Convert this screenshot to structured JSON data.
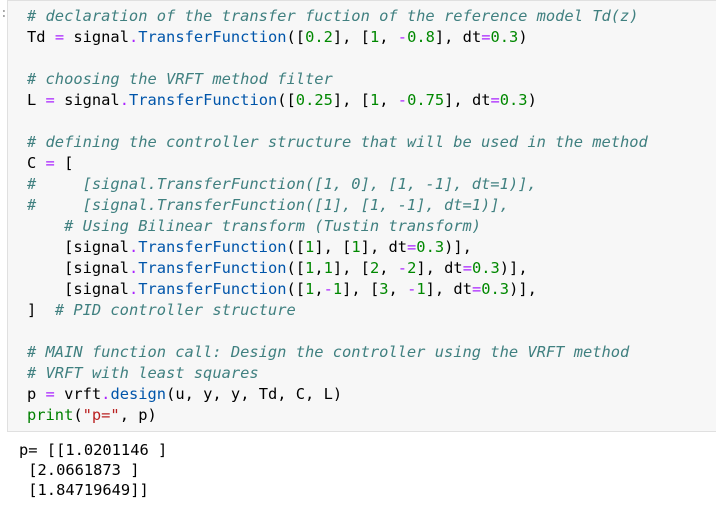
{
  "cell": {
    "prompt_mark": ":",
    "lines": [
      [
        {
          "t": "cm",
          "v": "# declaration of the transfer fuction of the reference model Td(z)"
        }
      ],
      [
        {
          "t": "p",
          "v": "Td "
        },
        {
          "t": "op",
          "v": "="
        },
        {
          "t": "p",
          "v": " signal"
        },
        {
          "t": "op",
          "v": "."
        },
        {
          "t": "fn",
          "v": "TransferFunction"
        },
        {
          "t": "p",
          "v": "(["
        },
        {
          "t": "num",
          "v": "0.2"
        },
        {
          "t": "p",
          "v": "], ["
        },
        {
          "t": "num",
          "v": "1"
        },
        {
          "t": "p",
          "v": ", "
        },
        {
          "t": "op",
          "v": "-"
        },
        {
          "t": "num",
          "v": "0.8"
        },
        {
          "t": "p",
          "v": "], dt"
        },
        {
          "t": "op",
          "v": "="
        },
        {
          "t": "num",
          "v": "0.3"
        },
        {
          "t": "p",
          "v": ")"
        }
      ],
      [],
      [
        {
          "t": "cm",
          "v": "# choosing the VRFT method filter"
        }
      ],
      [
        {
          "t": "p",
          "v": "L "
        },
        {
          "t": "op",
          "v": "="
        },
        {
          "t": "p",
          "v": " signal"
        },
        {
          "t": "op",
          "v": "."
        },
        {
          "t": "fn",
          "v": "TransferFunction"
        },
        {
          "t": "p",
          "v": "(["
        },
        {
          "t": "num",
          "v": "0.25"
        },
        {
          "t": "p",
          "v": "], ["
        },
        {
          "t": "num",
          "v": "1"
        },
        {
          "t": "p",
          "v": ", "
        },
        {
          "t": "op",
          "v": "-"
        },
        {
          "t": "num",
          "v": "0.75"
        },
        {
          "t": "p",
          "v": "], dt"
        },
        {
          "t": "op",
          "v": "="
        },
        {
          "t": "num",
          "v": "0.3"
        },
        {
          "t": "p",
          "v": ")"
        }
      ],
      [],
      [
        {
          "t": "cm",
          "v": "# defining the controller structure that will be used in the method"
        }
      ],
      [
        {
          "t": "p",
          "v": "C "
        },
        {
          "t": "op",
          "v": "="
        },
        {
          "t": "p",
          "v": " ["
        }
      ],
      [
        {
          "t": "cm",
          "v": "#     [signal.TransferFunction([1, 0], [1, -1], dt=1)],"
        }
      ],
      [
        {
          "t": "cm",
          "v": "#     [signal.TransferFunction([1], [1, -1], dt=1)],"
        }
      ],
      [
        {
          "t": "p",
          "v": "    "
        },
        {
          "t": "cm",
          "v": "# Using Bilinear transform (Tustin transform)"
        }
      ],
      [
        {
          "t": "p",
          "v": "    [signal"
        },
        {
          "t": "op",
          "v": "."
        },
        {
          "t": "fn",
          "v": "TransferFunction"
        },
        {
          "t": "p",
          "v": "(["
        },
        {
          "t": "num",
          "v": "1"
        },
        {
          "t": "p",
          "v": "], ["
        },
        {
          "t": "num",
          "v": "1"
        },
        {
          "t": "p",
          "v": "], dt"
        },
        {
          "t": "op",
          "v": "="
        },
        {
          "t": "num",
          "v": "0.3"
        },
        {
          "t": "p",
          "v": ")],"
        }
      ],
      [
        {
          "t": "p",
          "v": "    [signal"
        },
        {
          "t": "op",
          "v": "."
        },
        {
          "t": "fn",
          "v": "TransferFunction"
        },
        {
          "t": "p",
          "v": "(["
        },
        {
          "t": "num",
          "v": "1"
        },
        {
          "t": "p",
          "v": ","
        },
        {
          "t": "num",
          "v": "1"
        },
        {
          "t": "p",
          "v": "], ["
        },
        {
          "t": "num",
          "v": "2"
        },
        {
          "t": "p",
          "v": ", "
        },
        {
          "t": "op",
          "v": "-"
        },
        {
          "t": "num",
          "v": "2"
        },
        {
          "t": "p",
          "v": "], dt"
        },
        {
          "t": "op",
          "v": "="
        },
        {
          "t": "num",
          "v": "0.3"
        },
        {
          "t": "p",
          "v": ")],"
        }
      ],
      [
        {
          "t": "p",
          "v": "    [signal"
        },
        {
          "t": "op",
          "v": "."
        },
        {
          "t": "fn",
          "v": "TransferFunction"
        },
        {
          "t": "p",
          "v": "(["
        },
        {
          "t": "num",
          "v": "1"
        },
        {
          "t": "p",
          "v": ","
        },
        {
          "t": "op",
          "v": "-"
        },
        {
          "t": "num",
          "v": "1"
        },
        {
          "t": "p",
          "v": "], ["
        },
        {
          "t": "num",
          "v": "3"
        },
        {
          "t": "p",
          "v": ", "
        },
        {
          "t": "op",
          "v": "-"
        },
        {
          "t": "num",
          "v": "1"
        },
        {
          "t": "p",
          "v": "], dt"
        },
        {
          "t": "op",
          "v": "="
        },
        {
          "t": "num",
          "v": "0.3"
        },
        {
          "t": "p",
          "v": ")],"
        }
      ],
      [
        {
          "t": "p",
          "v": "]  "
        },
        {
          "t": "cm",
          "v": "# PID controller structure"
        }
      ],
      [],
      [
        {
          "t": "cm",
          "v": "# MAIN function call: Design the controller using the VRFT method"
        }
      ],
      [
        {
          "t": "cm",
          "v": "# VRFT with least squares"
        }
      ],
      [
        {
          "t": "p",
          "v": "p "
        },
        {
          "t": "op",
          "v": "="
        },
        {
          "t": "p",
          "v": " vrft"
        },
        {
          "t": "op",
          "v": "."
        },
        {
          "t": "fn",
          "v": "design"
        },
        {
          "t": "p",
          "v": "(u, y, y, Td, C, L)"
        }
      ],
      [
        {
          "t": "nb",
          "v": "print"
        },
        {
          "t": "p",
          "v": "("
        },
        {
          "t": "str",
          "v": "\"p=\""
        },
        {
          "t": "p",
          "v": ", p)"
        }
      ]
    ]
  },
  "output": {
    "lines": [
      "p= [[1.0201146 ]",
      " [2.0661873 ]",
      " [1.84719649]]"
    ]
  }
}
